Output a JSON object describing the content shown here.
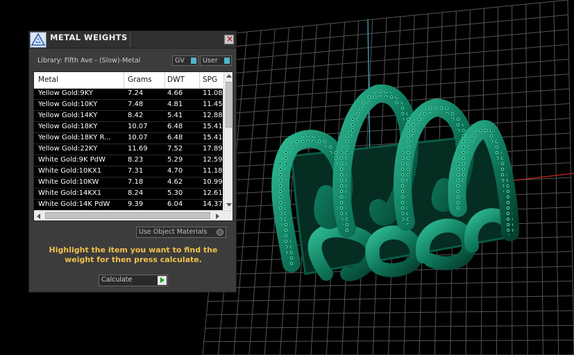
{
  "viewport": {
    "background": "#000000",
    "grid_color": "#555555",
    "axis_y_color": "#3fa7c4",
    "axis_x_color": "#c62828",
    "model_color": "#0f7a5e"
  },
  "panel": {
    "title": "METAL WEIGHTS",
    "close_glyph": "×",
    "library_label": "Library: Fifth Ave - (Slow)-Metal",
    "toggles": {
      "gv_label": "GV",
      "user_label": "User"
    },
    "table": {
      "headers": [
        "Metal",
        "Grams",
        "DWT",
        "SPG"
      ],
      "rows": [
        [
          "Yellow Gold:9KY",
          "7.24",
          "4.66",
          "11.08"
        ],
        [
          "Yellow Gold:10KY",
          "7.48",
          "4.81",
          "11.45"
        ],
        [
          "Yellow Gold:14KY",
          "8.42",
          "5.41",
          "12.88"
        ],
        [
          "Yellow Gold:18KY",
          "10.07",
          "6.48",
          "15.41"
        ],
        [
          "Yellow Gold:18KY R...",
          "10.07",
          "6.48",
          "15.41"
        ],
        [
          "Yellow Gold:22KY",
          "11.69",
          "7.52",
          "17.89"
        ],
        [
          "White Gold:9K PdW",
          "8.23",
          "5.29",
          "12.59"
        ],
        [
          "White Gold:10KX1",
          "7.31",
          "4.70",
          "11.18"
        ],
        [
          "White Gold:10KW",
          "7.18",
          "4.62",
          "10.99"
        ],
        [
          "White Gold:14KX1",
          "8.24",
          "5.30",
          "12.61"
        ],
        [
          "White Gold:14K PdW",
          "9.39",
          "6.04",
          "14.37"
        ]
      ]
    },
    "use_object_materials_label": "Use Object Materials",
    "hint": "Highlight the item you want to find the weight for then press calculate.",
    "calculate_label": "Calculate",
    "hint_color": "#f0c24a"
  }
}
